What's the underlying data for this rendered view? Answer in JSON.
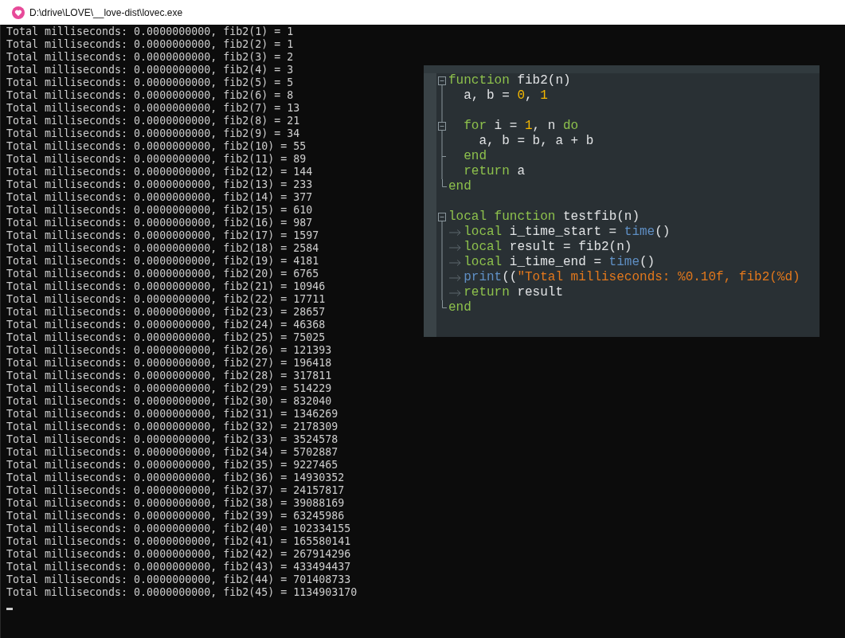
{
  "window": {
    "title": "D:\\drive\\LOVE\\__love-dist\\lovec.exe"
  },
  "console": {
    "lines": [
      "Total milliseconds: 0.0000000000, fib2(1) = 1",
      "Total milliseconds: 0.0000000000, fib2(2) = 1",
      "Total milliseconds: 0.0000000000, fib2(3) = 2",
      "Total milliseconds: 0.0000000000, fib2(4) = 3",
      "Total milliseconds: 0.0000000000, fib2(5) = 5",
      "Total milliseconds: 0.0000000000, fib2(6) = 8",
      "Total milliseconds: 0.0000000000, fib2(7) = 13",
      "Total milliseconds: 0.0000000000, fib2(8) = 21",
      "Total milliseconds: 0.0000000000, fib2(9) = 34",
      "Total milliseconds: 0.0000000000, fib2(10) = 55",
      "Total milliseconds: 0.0000000000, fib2(11) = 89",
      "Total milliseconds: 0.0000000000, fib2(12) = 144",
      "Total milliseconds: 0.0000000000, fib2(13) = 233",
      "Total milliseconds: 0.0000000000, fib2(14) = 377",
      "Total milliseconds: 0.0000000000, fib2(15) = 610",
      "Total milliseconds: 0.0000000000, fib2(16) = 987",
      "Total milliseconds: 0.0000000000, fib2(17) = 1597",
      "Total milliseconds: 0.0000000000, fib2(18) = 2584",
      "Total milliseconds: 0.0000000000, fib2(19) = 4181",
      "Total milliseconds: 0.0000000000, fib2(20) = 6765",
      "Total milliseconds: 0.0000000000, fib2(21) = 10946",
      "Total milliseconds: 0.0000000000, fib2(22) = 17711",
      "Total milliseconds: 0.0000000000, fib2(23) = 28657",
      "Total milliseconds: 0.0000000000, fib2(24) = 46368",
      "Total milliseconds: 0.0000000000, fib2(25) = 75025",
      "Total milliseconds: 0.0000000000, fib2(26) = 121393",
      "Total milliseconds: 0.0000000000, fib2(27) = 196418",
      "Total milliseconds: 0.0000000000, fib2(28) = 317811",
      "Total milliseconds: 0.0000000000, fib2(29) = 514229",
      "Total milliseconds: 0.0000000000, fib2(30) = 832040",
      "Total milliseconds: 0.0000000000, fib2(31) = 1346269",
      "Total milliseconds: 0.0000000000, fib2(32) = 2178309",
      "Total milliseconds: 0.0000000000, fib2(33) = 3524578",
      "Total milliseconds: 0.0000000000, fib2(34) = 5702887",
      "Total milliseconds: 0.0000000000, fib2(35) = 9227465",
      "Total milliseconds: 0.0000000000, fib2(36) = 14930352",
      "Total milliseconds: 0.0000000000, fib2(37) = 24157817",
      "Total milliseconds: 0.0000000000, fib2(38) = 39088169",
      "Total milliseconds: 0.0000000000, fib2(39) = 63245986",
      "Total milliseconds: 0.0000000000, fib2(40) = 102334155",
      "Total milliseconds: 0.0000000000, fib2(41) = 165580141",
      "Total milliseconds: 0.0000000000, fib2(42) = 267914296",
      "Total milliseconds: 0.0000000000, fib2(43) = 433494437",
      "Total milliseconds: 0.0000000000, fib2(44) = 701408733",
      "Total milliseconds: 0.0000000000, fib2(45) = 1134903170"
    ]
  },
  "editor": {
    "lines": [
      {
        "kind": "fold-start",
        "tokens": [
          {
            "kind": "keyword",
            "text": "function"
          },
          {
            "kind": "plain",
            "text": " fib2(n)"
          }
        ]
      },
      {
        "kind": "fold-body",
        "tokens": [
          {
            "kind": "plain",
            "text": "  a, b = "
          },
          {
            "kind": "number",
            "text": "0"
          },
          {
            "kind": "plain",
            "text": ", "
          },
          {
            "kind": "number",
            "text": "1"
          }
        ]
      },
      {
        "kind": "fold-body"
      },
      {
        "kind": "fold-nested-start",
        "tokens": [
          {
            "kind": "space"
          },
          {
            "kind": "space"
          },
          {
            "kind": "keyword",
            "text": "for"
          },
          {
            "kind": "plain",
            "text": " i = "
          },
          {
            "kind": "number",
            "text": "1"
          },
          {
            "kind": "plain",
            "text": ", n "
          },
          {
            "kind": "keyword",
            "text": "do"
          }
        ]
      },
      {
        "kind": "fold-body",
        "tokens": [
          {
            "kind": "plain",
            "text": "    a, b = b, a + b"
          }
        ]
      },
      {
        "kind": "fold-branch",
        "tokens": [
          {
            "kind": "space"
          },
          {
            "kind": "space"
          },
          {
            "kind": "keyword",
            "text": "end"
          }
        ]
      },
      {
        "kind": "fold-body",
        "tokens": [
          {
            "kind": "space"
          },
          {
            "kind": "space"
          },
          {
            "kind": "keyword",
            "text": "return"
          },
          {
            "kind": "plain",
            "text": " a"
          }
        ]
      },
      {
        "kind": "fold-end",
        "tokens": [
          {
            "kind": "keyword",
            "text": "end"
          }
        ]
      },
      {
        "kind": "blank"
      },
      {
        "kind": "fold-start",
        "tokens": [
          {
            "kind": "keyword",
            "text": "local"
          },
          {
            "kind": "space"
          },
          {
            "kind": "keyword",
            "text": "function"
          },
          {
            "kind": "plain",
            "text": " testfib(n)"
          }
        ]
      },
      {
        "kind": "fold-body",
        "tokens": [
          {
            "kind": "tab"
          },
          {
            "kind": "keyword",
            "text": "local"
          },
          {
            "kind": "plain",
            "text": " i_time_start = "
          },
          {
            "kind": "builtin",
            "text": "time"
          },
          {
            "kind": "plain",
            "text": "()"
          }
        ]
      },
      {
        "kind": "fold-body",
        "tokens": [
          {
            "kind": "tab"
          },
          {
            "kind": "keyword",
            "text": "local"
          },
          {
            "kind": "plain",
            "text": " result = fib2(n)"
          }
        ]
      },
      {
        "kind": "fold-body",
        "tokens": [
          {
            "kind": "tab"
          },
          {
            "kind": "keyword",
            "text": "local"
          },
          {
            "kind": "plain",
            "text": " i_time_end = "
          },
          {
            "kind": "builtin",
            "text": "time"
          },
          {
            "kind": "plain",
            "text": "()"
          }
        ]
      },
      {
        "kind": "fold-body",
        "tokens": [
          {
            "kind": "tab"
          },
          {
            "kind": "builtin",
            "text": "print"
          },
          {
            "kind": "plain",
            "text": "(("
          },
          {
            "kind": "string",
            "text": "\"Total milliseconds: %0.10f, fib2(%d)"
          }
        ]
      },
      {
        "kind": "fold-body",
        "tokens": [
          {
            "kind": "tab"
          },
          {
            "kind": "keyword",
            "text": "return"
          },
          {
            "kind": "plain",
            "text": " result"
          }
        ]
      },
      {
        "kind": "fold-end",
        "tokens": [
          {
            "kind": "keyword",
            "text": "end"
          }
        ]
      }
    ]
  }
}
